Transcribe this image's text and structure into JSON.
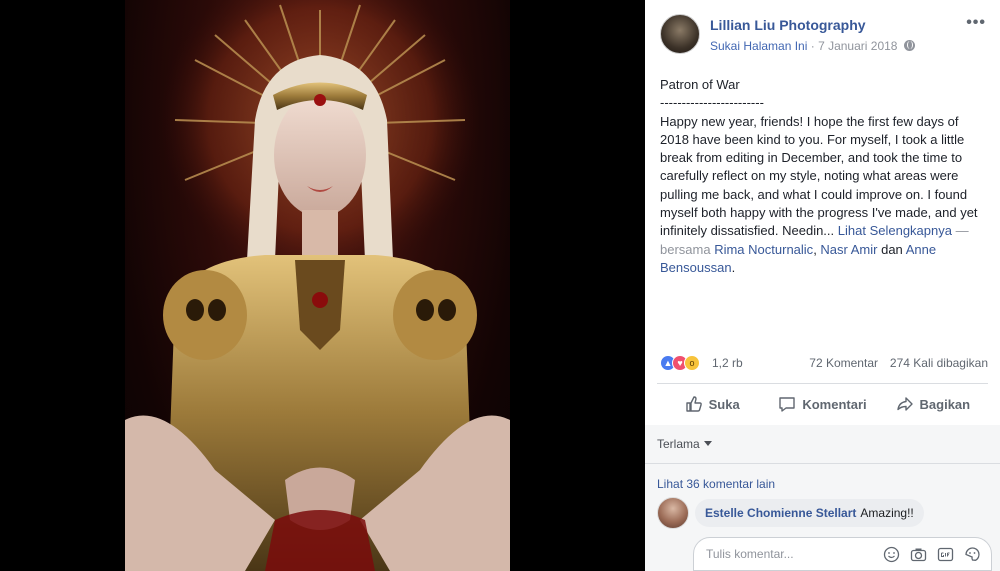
{
  "post": {
    "page_name": "Lillian Liu Photography",
    "like_page": "Sukai Halaman Ini",
    "date": "7 Januari 2018",
    "more": "•••",
    "title": "Patron of War",
    "separator": "------------------------",
    "body": "Happy new year, friends! I hope the first few days of 2018 have been kind to you. For myself, I took a little break from editing in December, and took the time to carefully reflect on my style, noting what areas were pulling me back, and what I could improve on. I found myself both happy with the progress I've made, and yet infinitely dissatisfied. Needin...",
    "see_more": "Lihat Selengkapnya",
    "with_sep": " — bersama ",
    "tag1": "Rima Nocturnalic",
    "comma": ", ",
    "tag2": "Nasr Amir",
    "and": " dan ",
    "tag3": "Anne Bensoussan",
    "period": "."
  },
  "stats": {
    "reactions": "1,2 rb",
    "comments": "72 Komentar",
    "shares": "274 Kali dibagikan"
  },
  "actions": {
    "like": "Suka",
    "comment": "Komentari",
    "share": "Bagikan"
  },
  "comments": {
    "sort": "Terlama",
    "view_more": "Lihat 36 komentar lain",
    "items": [
      {
        "author": "Estelle Chomienne Stellart",
        "text": "Amazing!!"
      }
    ],
    "input_placeholder": "Tulis komentar..."
  },
  "colors": {
    "link": "#385898",
    "muted": "#90949c",
    "like": "#4a7bf0",
    "love": "#f0506e",
    "wow": "#f7c33b"
  }
}
